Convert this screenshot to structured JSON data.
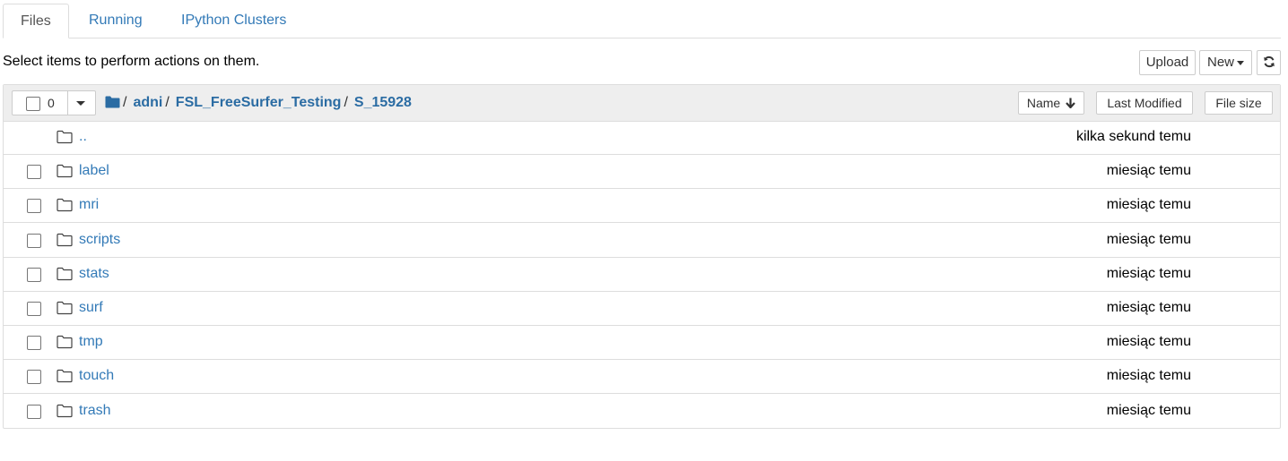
{
  "tabs": [
    {
      "label": "Files"
    },
    {
      "label": "Running"
    },
    {
      "label": "IPython Clusters"
    }
  ],
  "toolbar": {
    "hint": "Select items to perform actions on them.",
    "upload_label": "Upload",
    "new_label": "New",
    "refresh_icon": "refresh-icon"
  },
  "list_header": {
    "selected_count": "0",
    "breadcrumb": [
      "adni",
      "FSL_FreeSurfer_Testing",
      "S_15928"
    ],
    "separator": "/",
    "sort_name_label": "Name",
    "sort_modified_label": "Last Modified",
    "sort_size_label": "File size"
  },
  "rows": [
    {
      "name": "..",
      "modified": "kilka sekund temu",
      "checkbox": false
    },
    {
      "name": "label",
      "modified": "miesiąc temu",
      "checkbox": true
    },
    {
      "name": "mri",
      "modified": "miesiąc temu",
      "checkbox": true
    },
    {
      "name": "scripts",
      "modified": "miesiąc temu",
      "checkbox": true
    },
    {
      "name": "stats",
      "modified": "miesiąc temu",
      "checkbox": true
    },
    {
      "name": "surf",
      "modified": "miesiąc temu",
      "checkbox": true
    },
    {
      "name": "tmp",
      "modified": "miesiąc temu",
      "checkbox": true
    },
    {
      "name": "touch",
      "modified": "miesiąc temu",
      "checkbox": true
    },
    {
      "name": "trash",
      "modified": "miesiąc temu",
      "checkbox": true
    }
  ],
  "colors": {
    "link": "#337ab7",
    "breadcrumb": "#2b6ca3",
    "header_bg": "#eeeeee",
    "border": "#dddddd"
  }
}
